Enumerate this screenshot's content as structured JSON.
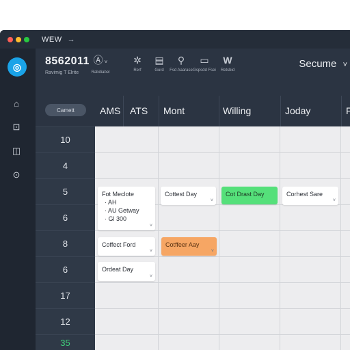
{
  "window": {
    "title": "WEW",
    "forward_glyph": "→"
  },
  "traffic_lights": {
    "close": "#ff5f57",
    "minimize": "#febc2e",
    "maximize": "#28c840"
  },
  "sidebar": {
    "logo_glyph": "◎",
    "items": [
      {
        "icon": "home-icon",
        "glyph": "⌂"
      },
      {
        "icon": "calendar-icon",
        "glyph": "⊡"
      },
      {
        "icon": "files-icon",
        "glyph": "◫"
      },
      {
        "icon": "settings-icon",
        "glyph": "⊙"
      }
    ]
  },
  "toolbar": {
    "calendar_title": "8562011",
    "calendar_subtitle": "Ravimig T Elrite",
    "account_glyph": "Ⓐ",
    "account_label": "Rabdiabel",
    "account_chevron": "˅",
    "tools": [
      {
        "icon": "gear-icon",
        "glyph": "✲",
        "label": "Rerf"
      },
      {
        "icon": "clipboard-icon",
        "glyph": "▤",
        "label": "Gurd"
      },
      {
        "icon": "search-icon",
        "glyph": "⚲",
        "label": "Fsd Aaarase"
      },
      {
        "icon": "monitor-icon",
        "glyph": "▭",
        "label": "Gspsdd Fsei"
      },
      {
        "icon": "w-icon",
        "glyph": "W",
        "label": "Retsbid"
      }
    ],
    "view_selector": "Secume",
    "view_chevron": "˅"
  },
  "header": {
    "today_button": "Camett",
    "columns": [
      "AMS",
      "ATS",
      "Mont",
      "Willing",
      "Joday",
      "F"
    ]
  },
  "time_slots": [
    "10",
    "4",
    "5",
    "6",
    "8",
    "6",
    "17",
    "12",
    "35"
  ],
  "events": [
    {
      "title": "Fot Meclote",
      "lines": [
        "· AH",
        "· AU Getway",
        "· Gl 300"
      ],
      "color": "white",
      "chevron": "˅"
    },
    {
      "title": "Cottest Day",
      "lines": [],
      "color": "white",
      "chevron": "˅"
    },
    {
      "title": "Cot Drast Day",
      "lines": [],
      "color": "green",
      "chevron": "˅"
    },
    {
      "title": "Corhest Sare",
      "lines": [],
      "color": "white",
      "chevron": "˅"
    },
    {
      "title": "Coffect Ford",
      "lines": [],
      "color": "white",
      "chevron": "˅"
    },
    {
      "title": "Cotffeer Aay",
      "lines": [],
      "color": "orange",
      "chevron": "˅"
    },
    {
      "title": "Ordeat Day",
      "lines": [],
      "color": "white",
      "chevron": "˅"
    }
  ],
  "colors": {
    "accent": "#1aa3e8",
    "event_green": "#55e07a",
    "event_orange": "#f6a664",
    "time_highlight": "#3fd07a"
  }
}
